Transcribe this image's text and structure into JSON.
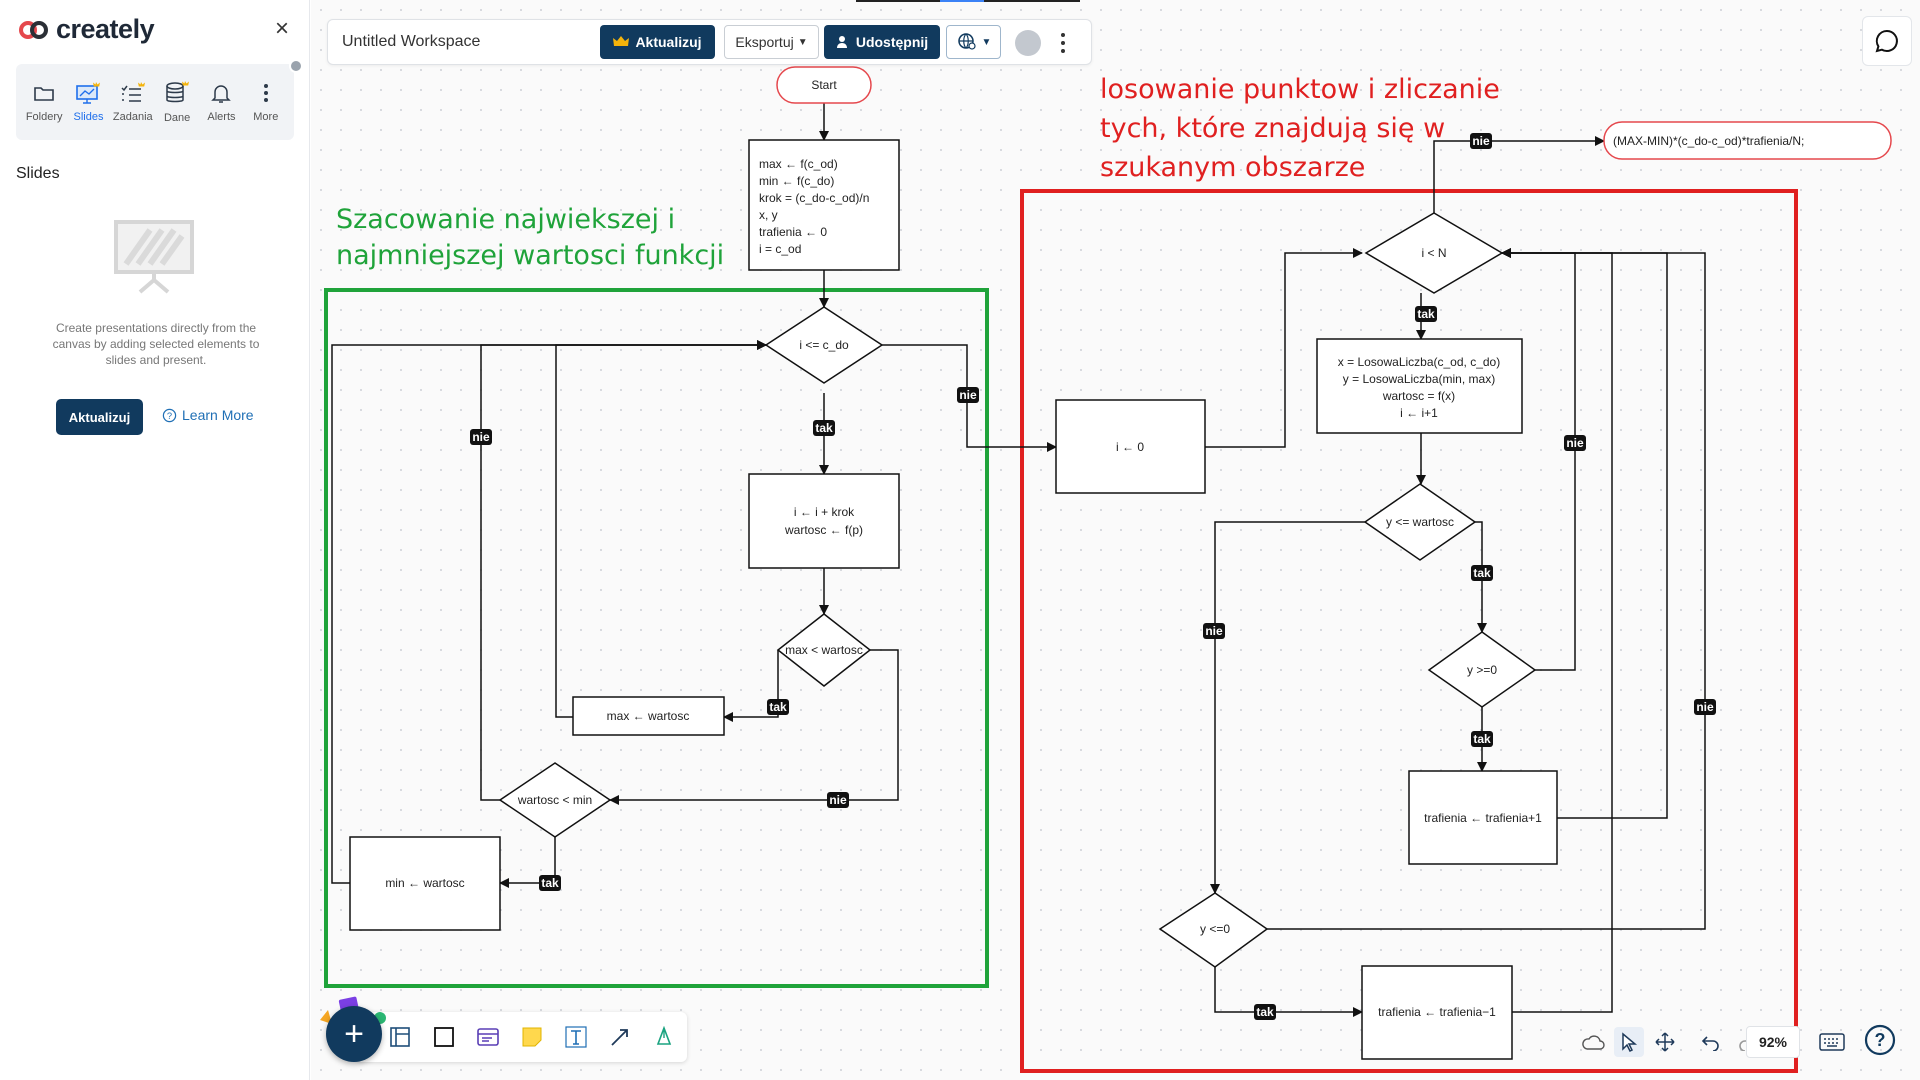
{
  "app": {
    "brand": "creately",
    "workspace_title": "Untitled Workspace"
  },
  "sidebar": {
    "tools": [
      {
        "label": "Foldery",
        "icon": "folder-icon"
      },
      {
        "label": "Slides",
        "icon": "slides-icon",
        "active": true,
        "premium": true
      },
      {
        "label": "Zadania",
        "icon": "tasks-icon",
        "premium": true
      },
      {
        "label": "Dane",
        "icon": "database-icon",
        "premium": true
      },
      {
        "label": "Alerts",
        "icon": "bell-icon"
      },
      {
        "label": "More",
        "icon": "more-icon"
      }
    ],
    "heading": "Slides",
    "description": "Create presentations directly from the canvas by adding selected elements to slides and present.",
    "upgrade_label": "Aktualizuj",
    "learn_more_label": "Learn More"
  },
  "topbar": {
    "upgrade_label": "Aktualizuj",
    "export_label": "Eksportuj",
    "share_label": "Udostępnij"
  },
  "annotations": {
    "green_text": [
      "Szacowanie najwiekszej i",
      "najmniejszej wartosci funkcji"
    ],
    "red_text": [
      "losowanie punktow i zliczanie",
      "tych, które znajdują się w",
      "szukanym obszarze"
    ],
    "green_color": "#1fa33a",
    "red_color": "#e02020"
  },
  "flowchart": {
    "start": "Start",
    "init": [
      "max ← f(c_od)",
      "min ← f(c_do)",
      "krok = (c_do-c_od)/n",
      "x, y",
      "trafienia ← 0",
      "i = c_od"
    ],
    "loop_cond": "i <= c_do",
    "step": [
      "i ← i + krok",
      "wartosc ← f(p)"
    ],
    "max_cond": "max < wartosc",
    "max_assign": "max ← wartosc",
    "min_cond": "wartosc < min",
    "min_assign": "min ← wartosc",
    "i_reset": "i ← 0",
    "outer_cond": "i < N",
    "random": [
      "x = LosowaLiczba(c_od, c_do)",
      "y = LosowaLiczba(min, max)",
      "wartosc = f(x)",
      "i ← i+1"
    ],
    "y_le_wartosc": "y <= wartosc",
    "y_ge_0": "y >=0",
    "inc": "trafienia ← trafienia+1",
    "y_le_0": "y <=0",
    "dec": "trafienia ← trafienia−1",
    "result": "(MAX-MIN)*(c_do-c_od)*trafienia/N;",
    "yes_label": "tak",
    "no_label": "nie"
  },
  "bottom_right": {
    "zoom": "92%"
  }
}
